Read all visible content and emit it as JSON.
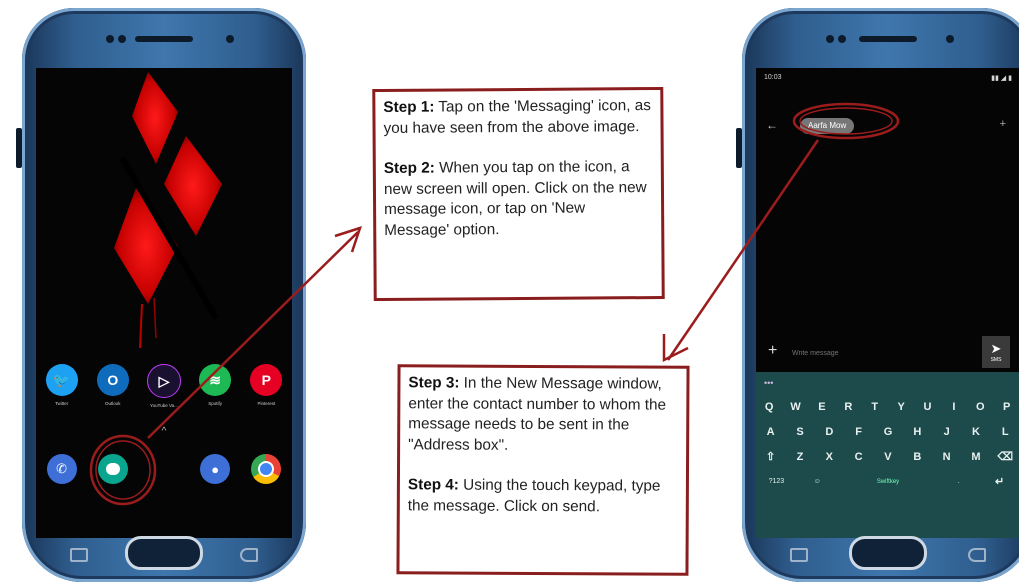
{
  "steps": {
    "box1": {
      "step1_label": "Step 1:",
      "step1_text": " Tap on the 'Messaging' icon, as you have seen from the above image.",
      "step2_label": "Step 2:",
      "step2_text": " When you tap on the icon, a new screen will open. Click on the new message icon, or tap on 'New Message' option."
    },
    "box2": {
      "step3_label": "Step 3:",
      "step3_text": " In the New Message window, enter the contact number to whom the message needs to be sent in the \"Address box\".",
      "step4_label": "Step 4:",
      "step4_text": " Using the touch keypad, type the message. Click on send."
    }
  },
  "left_phone": {
    "apps": [
      {
        "name": "twitter",
        "label": "Twitter",
        "color": "#1da1f2",
        "glyph": "🐦"
      },
      {
        "name": "outlook",
        "label": "Outlook",
        "color": "#0f6cbd",
        "glyph": "O"
      },
      {
        "name": "youtube-vanced",
        "label": "YouTube Va...",
        "color": "#1a1030",
        "glyph": "▷"
      },
      {
        "name": "spotify",
        "label": "Spotify",
        "color": "#1db954",
        "glyph": "≋"
      },
      {
        "name": "pinterest",
        "label": "Pinterest",
        "color": "#e60023",
        "glyph": "P"
      }
    ],
    "dock": [
      {
        "name": "phone",
        "color": "#3d6fd6",
        "glyph": "✆"
      },
      {
        "name": "messaging",
        "color": "#0aa58f",
        "glyph": "●"
      },
      {
        "name": "contacts",
        "color": "#3d6fd6",
        "glyph": "👤"
      },
      {
        "name": "chrome",
        "color": "#ffffff",
        "glyph": "◉"
      }
    ]
  },
  "right_phone": {
    "status_time": "10:03",
    "recipient": "Aarfa Mow",
    "compose_placeholder": "Write message",
    "send_label": "SMS",
    "keyboard": {
      "row1": [
        "Q",
        "W",
        "E",
        "R",
        "T",
        "Y",
        "U",
        "I",
        "O",
        "P"
      ],
      "row2": [
        "A",
        "S",
        "D",
        "F",
        "G",
        "H",
        "J",
        "K",
        "L"
      ],
      "row3": [
        "⇧",
        "Z",
        "X",
        "C",
        "V",
        "B",
        "N",
        "M",
        "⌫"
      ],
      "row4_left": "?123",
      "row4_space": "Swiftkey",
      "row4_right": "↵"
    }
  },
  "colors": {
    "annotation_red": "#9b1c1c",
    "box_border": "#8a1e1e"
  }
}
